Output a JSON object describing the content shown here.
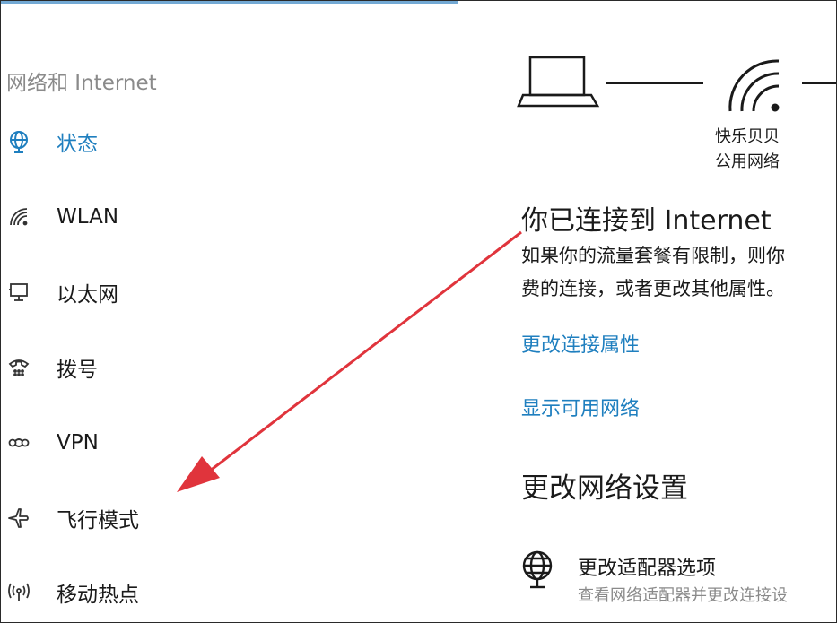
{
  "sidebar": {
    "section_title": "网络和 Internet",
    "items": [
      {
        "label": "状态",
        "icon": "globe-icon",
        "active": true
      },
      {
        "label": "WLAN",
        "icon": "wifi-icon",
        "active": false
      },
      {
        "label": "以太网",
        "icon": "ethernet-icon",
        "active": false
      },
      {
        "label": "拨号",
        "icon": "dialup-icon",
        "active": false
      },
      {
        "label": "VPN",
        "icon": "vpn-icon",
        "active": false
      },
      {
        "label": "飞行模式",
        "icon": "airplane-icon",
        "active": false
      },
      {
        "label": "移动热点",
        "icon": "hotspot-icon",
        "active": false
      }
    ]
  },
  "main": {
    "network_name_line1": "快乐贝贝",
    "network_name_line2": "公用网络",
    "connection_title": "你已连接到 Internet",
    "connection_desc_line1": "如果你的流量套餐有限制，则你",
    "connection_desc_line2": "费的连接，或者更改其他属性。",
    "link_change_properties": "更改连接属性",
    "link_show_networks": "显示可用网络",
    "section_heading": "更改网络设置",
    "adapter_title": "更改适配器选项",
    "adapter_subtitle": "查看网络适配器并更改连接设"
  },
  "colors": {
    "accent": "#1f7fbf",
    "annotation_arrow": "#e0343c",
    "muted": "#8a8a8a"
  }
}
